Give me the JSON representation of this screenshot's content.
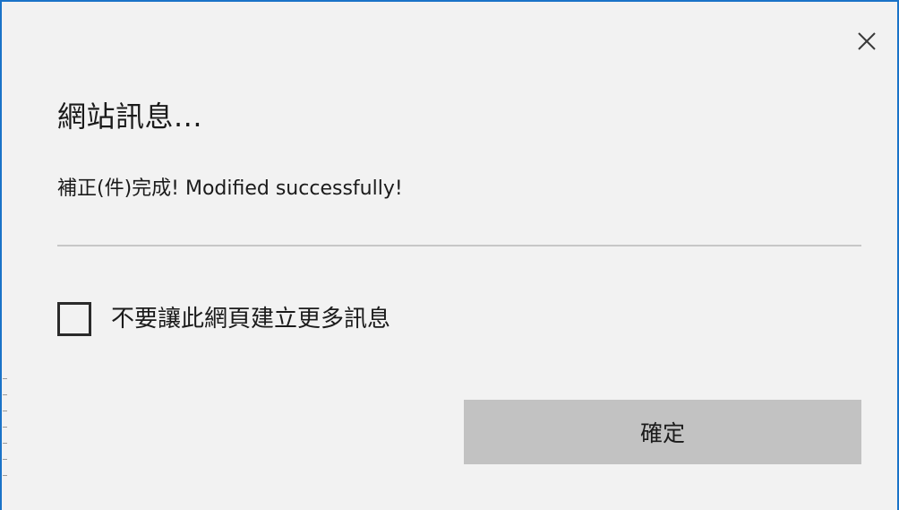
{
  "dialog": {
    "title": "網站訊息...",
    "message": "補正(件)完成! Modified successfully!",
    "checkbox": {
      "label": "不要讓此網頁建立更多訊息",
      "checked": false
    },
    "ok_button_label": "確定",
    "close_icon": "close-icon"
  },
  "colors": {
    "dialog_background": "#f2f2f2",
    "frame_border": "#1a73c8",
    "button_background": "#c2c2c2",
    "divider": "#c7c7c7",
    "text": "#1b1b1b"
  }
}
